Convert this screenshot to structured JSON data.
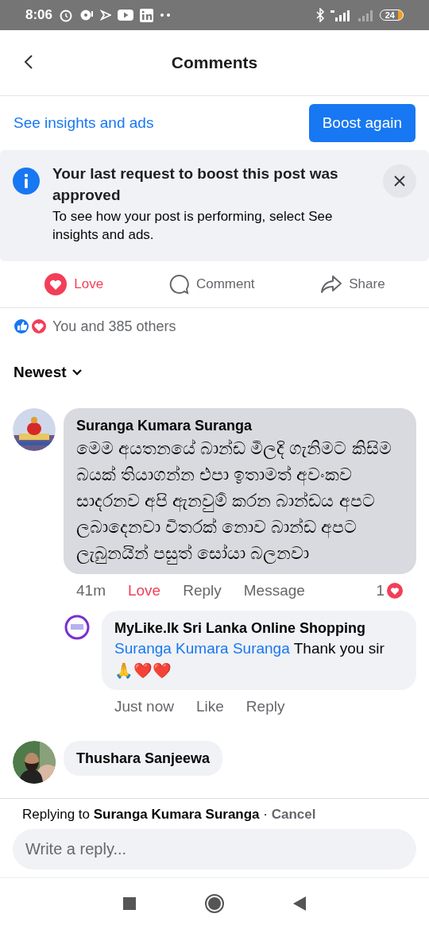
{
  "status_bar": {
    "time": "8:06",
    "battery": "24"
  },
  "header": {
    "title": "Comments"
  },
  "promo": {
    "link": "See insights and ads",
    "button": "Boost again"
  },
  "notice": {
    "title": "Your last request to boost this post was approved",
    "body": "To see how your post is performing, select See insights and ads."
  },
  "post_actions": [
    {
      "kind": "love",
      "label": "Love",
      "selected": true
    },
    {
      "kind": "comment",
      "label": "Comment",
      "selected": false
    },
    {
      "kind": "share",
      "label": "Share",
      "selected": false
    }
  ],
  "reactions": {
    "text": "You and 385 others"
  },
  "sort": {
    "label": "Newest"
  },
  "comments": [
    {
      "author": "Suranga Kumara Suranga",
      "avatar": {
        "kind": "picture"
      },
      "text": "මෙම අයතනයේ බාන්ඩ මීලදි ගැනිමට කිසිම බයක් තියාගන්න එපා ඉතාමත් අවංකව සාදරනව අපි ඇනවුම් කරන බාන්ඩය අපට ලබාදෙනවා විතරක් නොව බාන්ඩ අපට ලැබුනයින් පසුත් සෝයා බලනවා",
      "time": "41m",
      "actions": [
        {
          "label": "Love",
          "selected": true
        },
        {
          "label": "Reply",
          "selected": false
        },
        {
          "label": "Message",
          "selected": false
        }
      ],
      "reaction_count": "1",
      "replies": [
        {
          "author": "MyLike.lk Sri Lanka Online Shopping",
          "avatar": {
            "kind": "logo"
          },
          "mention": "Suranga Kumara Suranga",
          "text": "Thank you sir 🙏❤️❤️",
          "time": "Just now",
          "actions": [
            {
              "label": "Like",
              "selected": false
            },
            {
              "label": "Reply",
              "selected": false
            }
          ]
        }
      ]
    },
    {
      "author": "Thushara Sanjeewa",
      "avatar": {
        "kind": "picture"
      }
    }
  ],
  "composer": {
    "prefix": "Replying to",
    "name": "Suranga Kumara Suranga",
    "separator": "·",
    "cancel": "Cancel",
    "placeholder": "Write a reply..."
  }
}
